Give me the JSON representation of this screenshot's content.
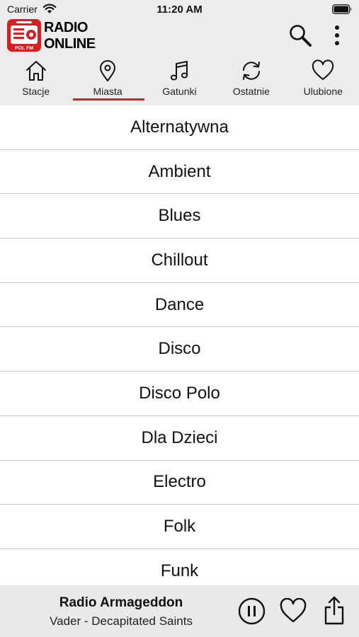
{
  "status_bar": {
    "carrier": "Carrier",
    "time": "11:20 AM"
  },
  "logo": {
    "line1": "RADIO",
    "line2": "ONLINE",
    "badge_text": "POL FM"
  },
  "colors": {
    "accent": "#d81e1e",
    "header_bg": "#ececec",
    "player_bg": "#e9e9e9",
    "divider": "#c8c8c8"
  },
  "tabs": [
    {
      "label": "Stacje",
      "icon": "home-icon"
    },
    {
      "label": "Miasta",
      "icon": "location-pin-icon"
    },
    {
      "label": "Gatunki",
      "icon": "music-note-icon",
      "selected": true
    },
    {
      "label": "Ostatnie",
      "icon": "refresh-icon"
    },
    {
      "label": "Ulubione",
      "icon": "heart-icon"
    }
  ],
  "genres": [
    "Alternatywna",
    "Ambient",
    "Blues",
    "Chillout",
    "Dance",
    "Disco",
    "Disco Polo",
    "Dla Dzieci",
    "Electro",
    "Folk",
    "Funk"
  ],
  "player": {
    "station": "Radio Armageddon",
    "track": "Vader - Decapitated Saints"
  }
}
